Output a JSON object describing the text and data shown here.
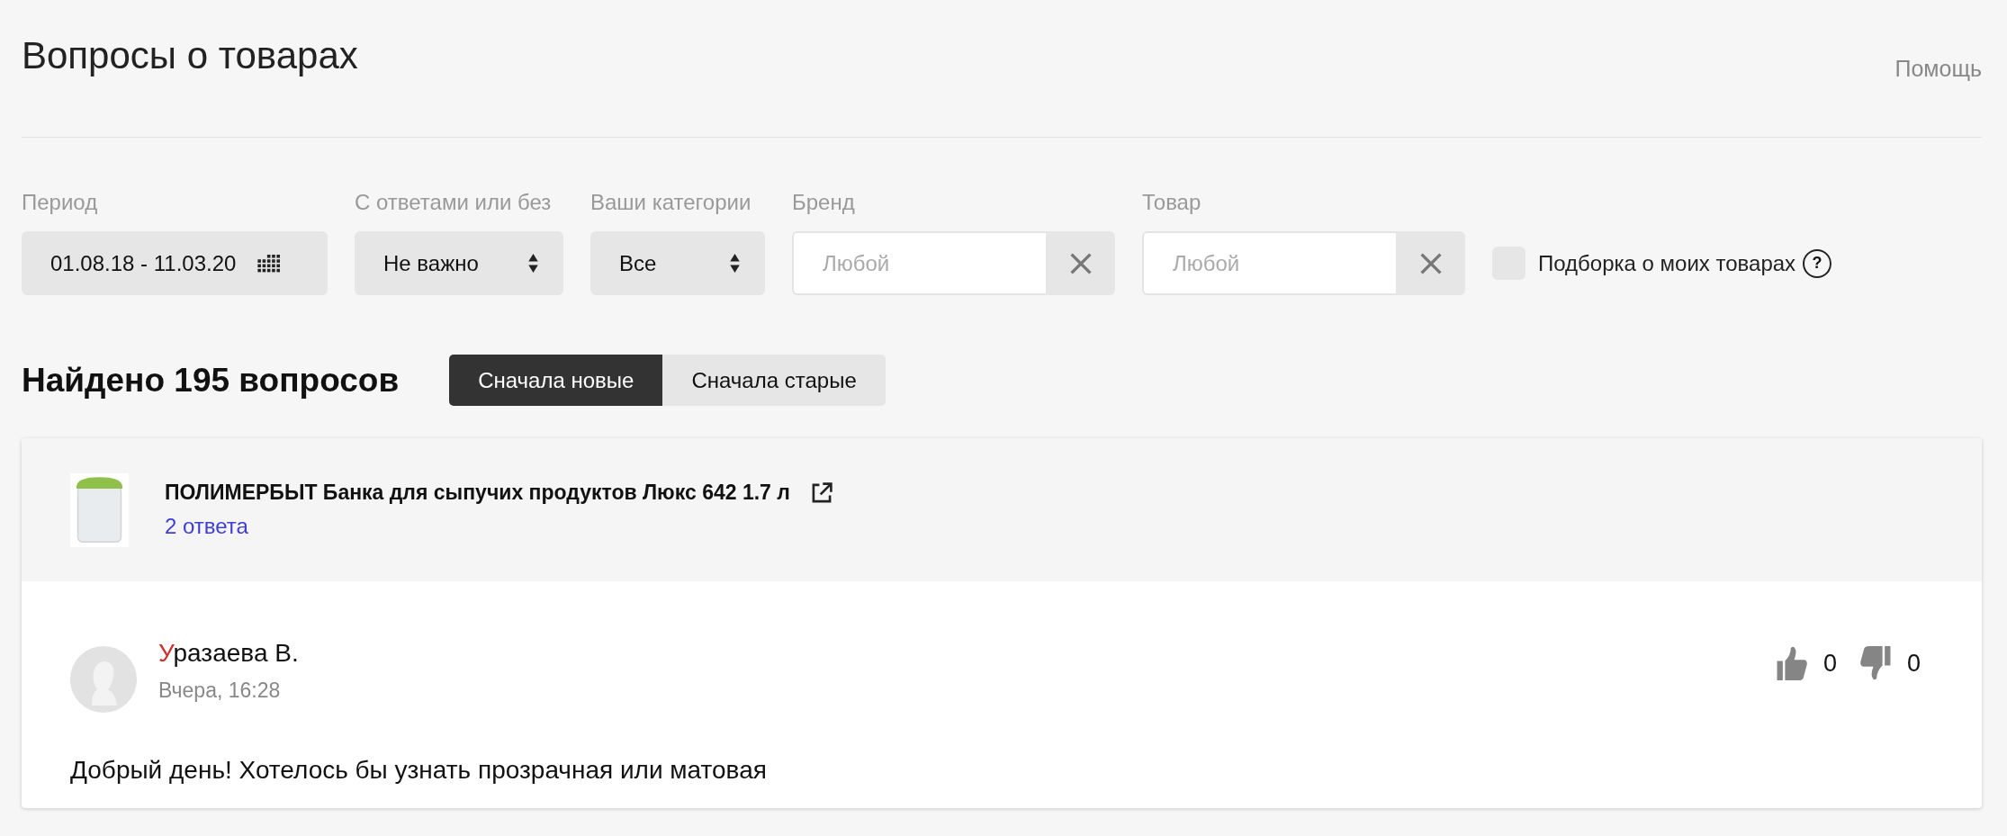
{
  "page": {
    "title": "Вопросы о товарах",
    "help_link": "Помощь"
  },
  "filters": [
    {
      "kind": "date",
      "label": "Период",
      "value": "01.08.18 - 11.03.20"
    },
    {
      "kind": "select",
      "label": "С ответами или без",
      "value": "Не важно"
    },
    {
      "kind": "select",
      "label": "Ваши категории",
      "value": "Все"
    },
    {
      "kind": "search",
      "label": "Бренд",
      "placeholder": "Любой"
    },
    {
      "kind": "search",
      "label": "Товар",
      "placeholder": "Любой"
    }
  ],
  "my_products": {
    "label": "Подборка о моих товарах",
    "checked": false,
    "help_mark": "?"
  },
  "results": {
    "heading": "Найдено 195 вопросов",
    "sort_tabs": [
      {
        "label": "Сначала новые",
        "selected": true
      },
      {
        "label": "Сначала старые",
        "selected": false
      }
    ]
  },
  "questions": [
    {
      "product": {
        "title": "ПОЛИМЕРБЫТ Банка для сыпучих продуктов Люкс 642 1.7 л",
        "answers_link": "2 ответа"
      },
      "author": {
        "name_highlight": "У",
        "name_rest": "разаева В.",
        "date": "Вчера, 16:28"
      },
      "likes": "0",
      "dislikes": "0",
      "text": "Добрый день! Хотелось бы узнать прозрачная или матовая"
    }
  ]
}
